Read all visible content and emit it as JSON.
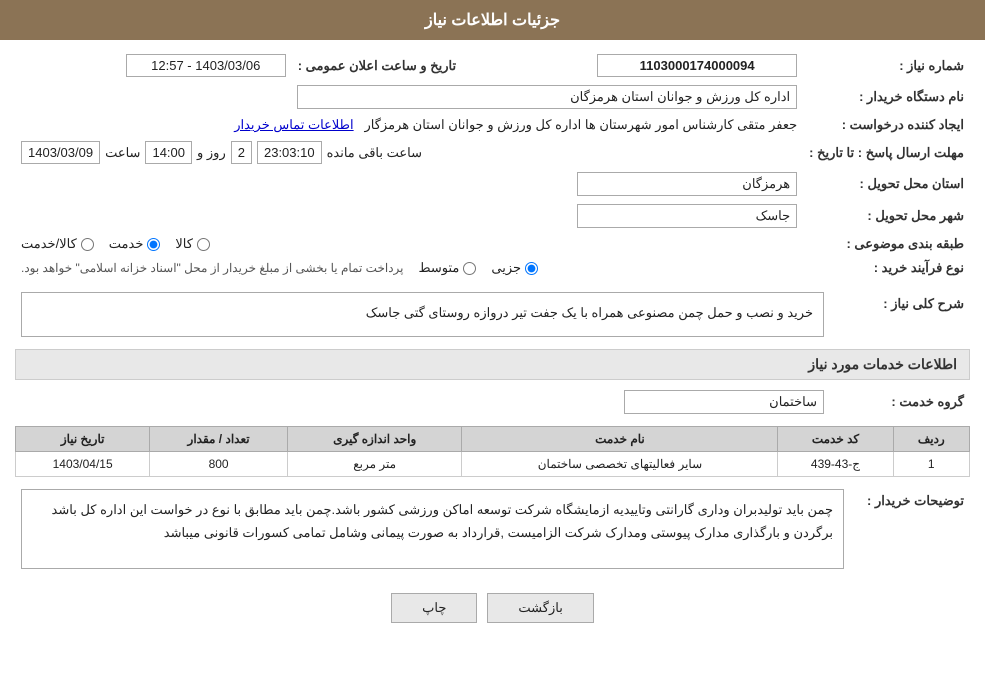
{
  "header": {
    "title": "جزئیات اطلاعات نیاز"
  },
  "fields": {
    "shmare_niyaz_label": "شماره نیاز :",
    "shmare_niyaz_value": "1103000174000094",
    "nam_dastgah_label": "نام دستگاه خریدار :",
    "nam_dastgah_value": "اداره کل ورزش و جوانان استان هرمزگان",
    "tarikh_label": "تاریخ و ساعت اعلان عمومی :",
    "tarikh_value": "1403/03/06 - 12:57",
    "ijad_label": "ایجاد کننده درخواست :",
    "ijad_value": "جعفر متقی کارشناس امور شهرستان ها اداره کل ورزش و جوانان استان هرمزگار",
    "ijad_link": "اطلاعات تماس خریدار",
    "mohlat_label": "مهلت ارسال پاسخ : تا تاریخ :",
    "mohlat_date": "1403/03/09",
    "mohlat_time": "14:00",
    "mohlat_day": "2",
    "mohlat_remaining": "23:03:10",
    "ostan_label": "استان محل تحویل :",
    "ostan_value": "هرمزگان",
    "shahr_label": "شهر محل تحویل :",
    "shahr_value": "جاسک",
    "tabaqe_label": "طبقه بندی موضوعی :",
    "tabaqe_kala": "کالا",
    "tabaqe_khadamat": "خدمت",
    "tabaqe_kala_khadamat": "کالا/خدمت",
    "tabaqe_selected": "khadamat",
    "nov_label": "نوع فرآیند خرید :",
    "nov_jazii": "جزیی",
    "nov_motavasset": "متوسط",
    "nov_description": "پرداخت تمام یا بخشی از مبلغ خریدار از محل \"اسناد خزانه اسلامی\" خواهد بود.",
    "sharh_label": "شرح کلی نیاز :",
    "sharh_value": "خرید و نصب و حمل چمن مصنوعی همراه با یک جفت تیر دروازه روستای گتی جاسک",
    "section2_title": "اطلاعات خدمات مورد نیاز",
    "group_label": "گروه خدمت :",
    "group_value": "ساختمان",
    "grid": {
      "headers": [
        "ردیف",
        "کد خدمت",
        "نام خدمت",
        "واحد اندازه گیری",
        "تعداد / مقدار",
        "تاریخ نیاز"
      ],
      "rows": [
        [
          "1",
          "ج-43-439",
          "سایر فعالیتهای تخصصی ساختمان",
          "متر مربع",
          "800",
          "1403/04/15"
        ]
      ]
    },
    "notes_label": "توضیحات خریدار :",
    "notes_value": "چمن باید تولیدبران وداری گارانتی وتاییدیه ازمایشگاه شرکت توسعه اماکن ورزشی کشور باشد.چمن باید مطابق با نوع در خواست این اداره کل باشد برگردن و بارگذاری مدارک پیوستی  ومدارک شرکت الزامیست ,قرارداد به صورت پیمانی وشامل تمامی کسورات قانونی میباشد",
    "btn_bazgasht": "بازگشت",
    "btn_chap": "چاپ"
  }
}
